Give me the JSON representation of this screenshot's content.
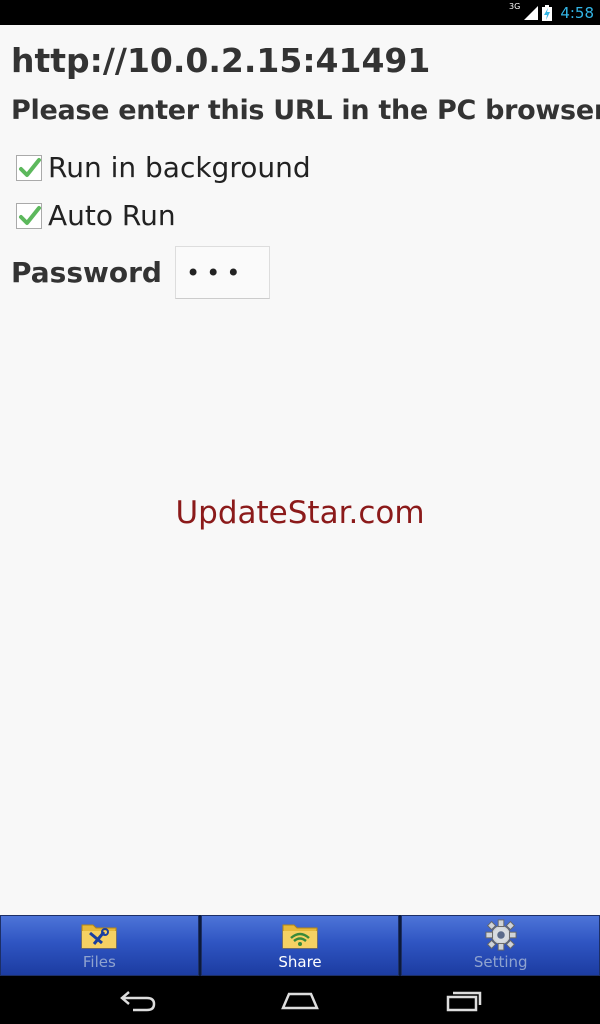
{
  "status_bar": {
    "network": "3G",
    "time": "4:58",
    "accent_color": "#33b5e5"
  },
  "main": {
    "server_url": "http://10.0.2.15:41491",
    "instruction": "Please enter this URL in the PC browser",
    "options": [
      {
        "label": "Run in background",
        "checked": true
      },
      {
        "label": "Auto Run",
        "checked": true
      }
    ],
    "password": {
      "label": "Password",
      "value": "•••"
    }
  },
  "watermark": "UpdateStar.com",
  "tabs": [
    {
      "label": "Files",
      "icon": "folder-tools-icon",
      "active": false
    },
    {
      "label": "Share",
      "icon": "folder-wifi-icon",
      "active": true
    },
    {
      "label": "Setting",
      "icon": "gear-icon",
      "active": false
    }
  ],
  "nav_bar": {
    "buttons": [
      "back-icon",
      "home-icon",
      "recent-apps-icon"
    ]
  }
}
